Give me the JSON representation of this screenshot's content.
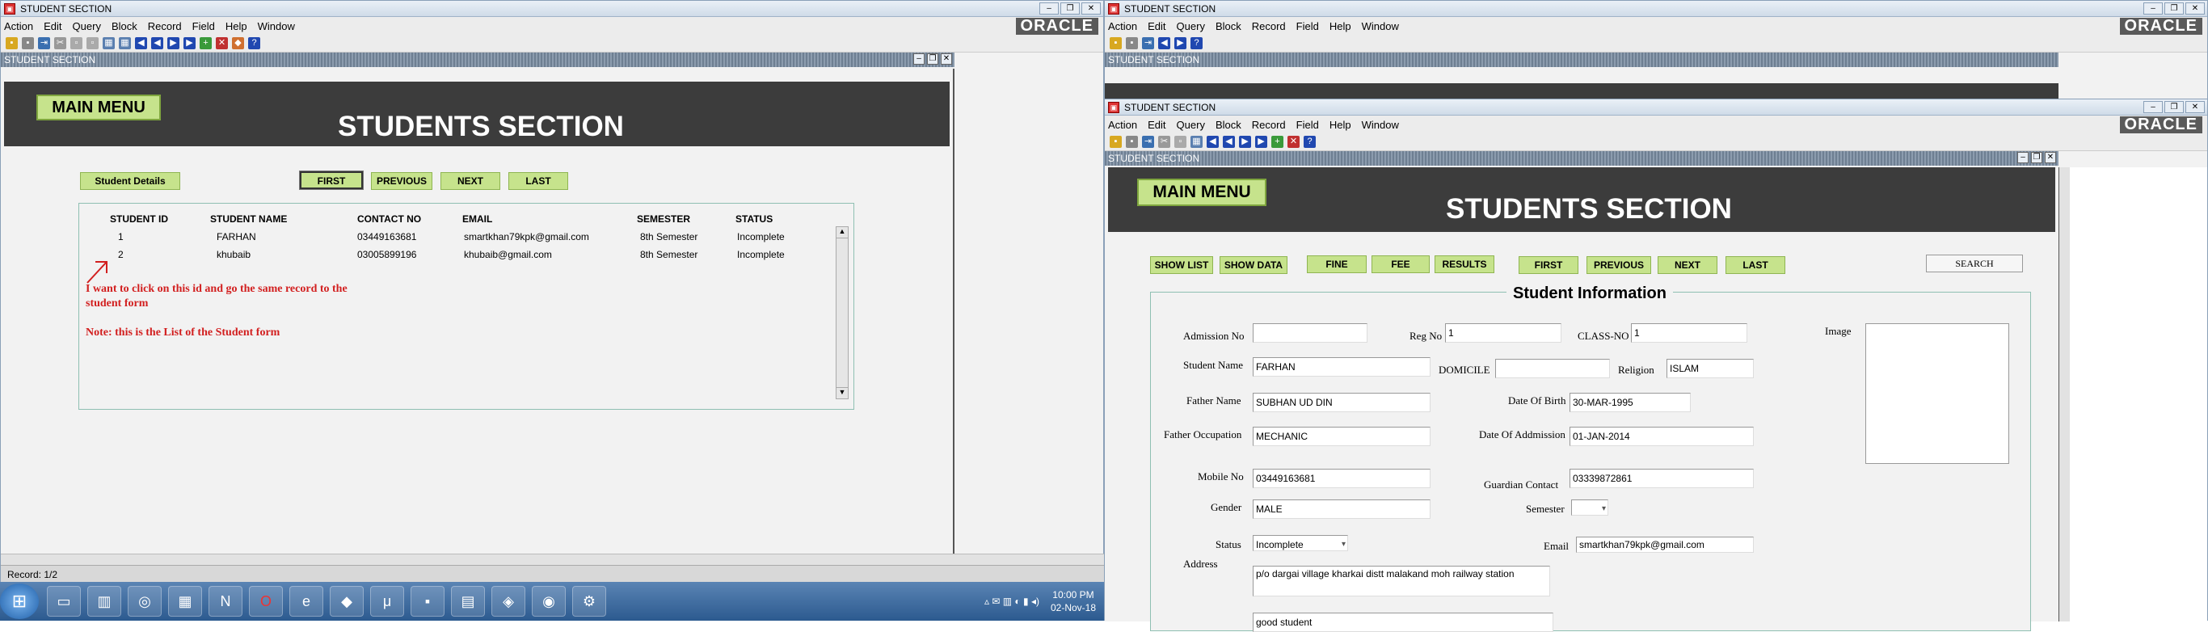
{
  "left": {
    "window_title": "STUDENT SECTION",
    "menu": [
      "Action",
      "Edit",
      "Query",
      "Block",
      "Record",
      "Field",
      "Help",
      "Window"
    ],
    "oracle": "ORACLE",
    "form_title": "STUDENT SECTION",
    "main_menu": "MAIN MENU",
    "heading": "STUDENTS SECTION",
    "student_details": "Student Details",
    "nav": [
      "FIRST",
      "PREVIOUS",
      "NEXT",
      "LAST"
    ],
    "columns": [
      "STUDENT ID",
      "STUDENT NAME",
      "CONTACT NO",
      "EMAIL",
      "SEMESTER",
      "STATUS"
    ],
    "rows": [
      {
        "id": "1",
        "name": "FARHAN",
        "contact": "03449163681",
        "email": "smartkhan79kpk@gmail.com",
        "semester": "8th Semester",
        "status": "Incomplete"
      },
      {
        "id": "2",
        "name": "khubaib",
        "contact": "03005899196",
        "email": "khubaib@gmail.com",
        "semester": "8th Semester",
        "status": "Incomplete"
      }
    ],
    "note1": "I want to click on this id and go the same record to the",
    "note2": "student form",
    "note3": "Note: this is the List of the Student form",
    "status": "Record: 1/2"
  },
  "right": {
    "window_title": "STUDENT SECTION",
    "menu": [
      "Action",
      "Edit",
      "Query",
      "Block",
      "Record",
      "Field",
      "Help",
      "Window"
    ],
    "oracle": "ORACLE",
    "form_title": "STUDENT SECTION",
    "main_menu": "MAIN MENU",
    "heading": "STUDENTS SECTION",
    "buttons": [
      "SHOW LIST",
      "SHOW DATA",
      "FINE",
      "FEE",
      "RESULTS",
      "FIRST",
      "PREVIOUS",
      "NEXT",
      "LAST"
    ],
    "search": "SEARCH",
    "info_title": "Student Information",
    "labels": {
      "admission": "Admission No",
      "reg": "Reg No",
      "class": "CLASS-NO",
      "image": "Image",
      "name": "Student Name",
      "domicile": "DOMICILE",
      "religion": "Religion",
      "father": "Father Name",
      "dob": "Date Of Birth",
      "occupation": "Father Occupation",
      "doa": "Date Of Addmission",
      "mobile": "Mobile No",
      "guardian": "Guardian Contact",
      "gender": "Gender",
      "semester": "Semester",
      "status": "Status",
      "email": "Email",
      "address": "Address"
    },
    "values": {
      "admission": "",
      "reg": "1",
      "class": "1",
      "name": "FARHAN",
      "domicile": "",
      "religion": "ISLAM",
      "father": "SUBHAN UD DIN",
      "dob": "30-MAR-1995",
      "occupation": "MECHANIC",
      "doa": "01-JAN-2014",
      "mobile": "03449163681",
      "guardian": "03339872861",
      "gender": "MALE",
      "semester": "",
      "status": "Incomplete",
      "email": "smartkhan79kpk@gmail.com",
      "address": "p/o dargai village kharkai distt malakand moh railway station",
      "remarks": "good student"
    }
  },
  "taskbar": {
    "time": "10:00 PM",
    "date": "02-Nov-18"
  }
}
